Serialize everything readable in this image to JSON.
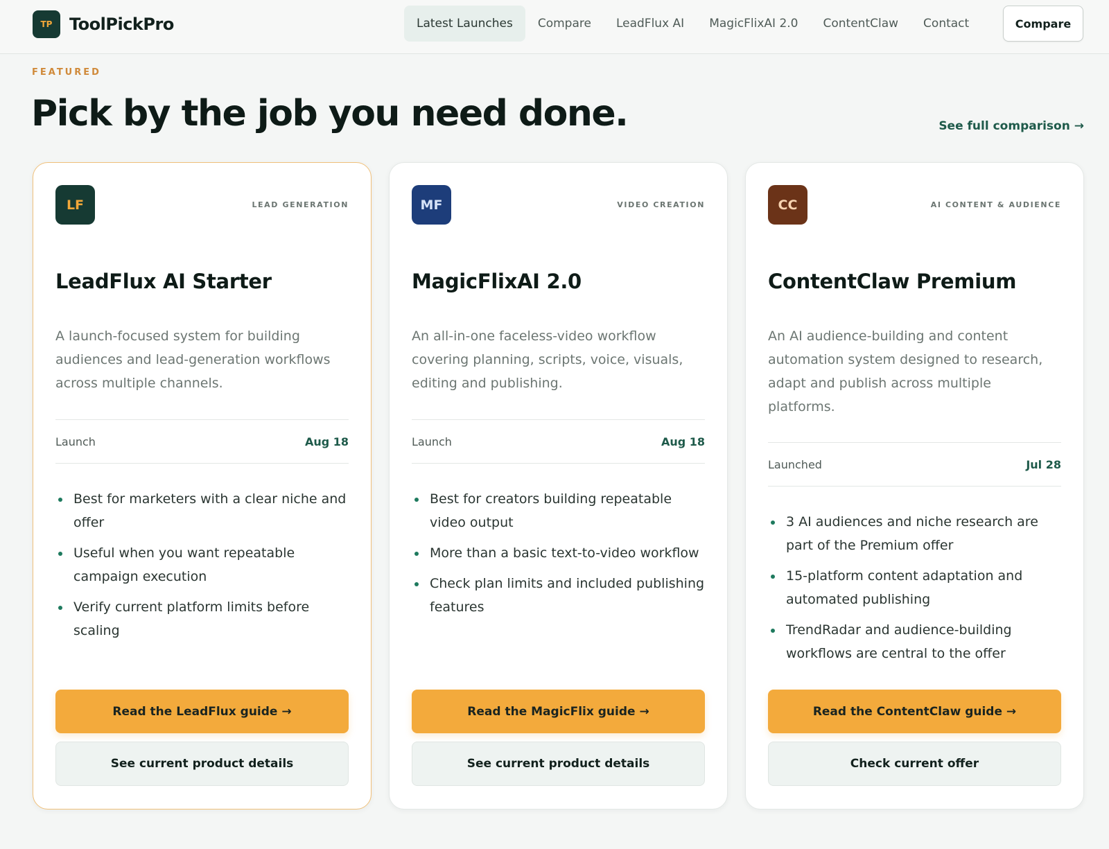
{
  "brand": {
    "mark": "TP",
    "name": "ToolPickPro"
  },
  "nav": {
    "links": [
      "Latest Launches",
      "Compare",
      "LeadFlux AI",
      "MagicFlixAI 2.0",
      "ContentClaw",
      "Contact"
    ],
    "active": "Latest Launches",
    "cta": "Compare"
  },
  "hero": {
    "eyebrow": "FEATURED",
    "title": "Pick by the job you need done.",
    "link": "See full comparison →"
  },
  "colors": {
    "accent": "#f3aa3c",
    "link_green": "#1e5a4a",
    "eyebrow_orange": "#d08a3a"
  },
  "cards": [
    {
      "logo": "LF",
      "logo_bg": "#163a33",
      "logo_fg": "#f3a83a",
      "category": "LEAD GENERATION",
      "title": "LeadFlux AI Starter",
      "description": "A launch-focused system for building audiences and lead-generation workflows across multiple channels.",
      "launch_label": "Launch",
      "launch_date": "Aug 18",
      "bullets": [
        "Best for marketers with a clear niche and offer",
        "Useful when you want repeatable campaign execution",
        "Verify current platform limits before scaling"
      ],
      "primary_cta": "Read the LeadFlux guide →",
      "secondary_cta": "See current product details"
    },
    {
      "logo": "MF",
      "logo_bg": "#1d3d7a",
      "logo_fg": "#d6e2f7",
      "category": "VIDEO CREATION",
      "title": "MagicFlixAI 2.0",
      "description": "An all-in-one faceless-video workflow covering planning, scripts, voice, visuals, editing and publishing.",
      "launch_label": "Launch",
      "launch_date": "Aug 18",
      "bullets": [
        "Best for creators building repeatable video output",
        "More than a basic text-to-video workflow",
        "Check plan limits and included publishing features"
      ],
      "primary_cta": "Read the MagicFlix guide →",
      "secondary_cta": "See current product details"
    },
    {
      "logo": "CC",
      "logo_bg": "#6b3318",
      "logo_fg": "#f7d3b0",
      "category": "AI CONTENT & AUDIENCE",
      "title": "ContentClaw Premium",
      "description": "An AI audience-building and content automation system designed to research, adapt and publish across multiple platforms.",
      "launch_label": "Launched",
      "launch_date": "Jul 28",
      "bullets": [
        "3 AI audiences and niche research are part of the Premium offer",
        "15-platform content adaptation and automated publishing",
        "TrendRadar and audience-building workflows are central to the offer"
      ],
      "primary_cta": "Read the ContentClaw guide →",
      "secondary_cta": "Check current offer"
    }
  ]
}
